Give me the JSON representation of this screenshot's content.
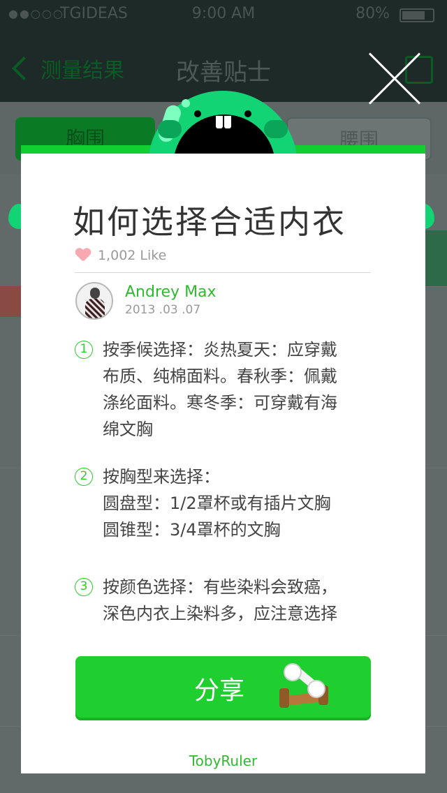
{
  "status_bar": {
    "signal": "●●○○○",
    "carrier": "TGIDEAS",
    "time": "9:00 AM",
    "battery": "80%"
  },
  "nav": {
    "back_label": "测量结果",
    "title": "改善贴士"
  },
  "segments": {
    "left": "胸围",
    "right": "腰围"
  },
  "card": {
    "title": "如何选择合适内衣",
    "likes": "1,002 Like",
    "author": {
      "name": "Andrey Max",
      "date": "2013 .03 .07"
    },
    "tips": [
      {
        "number": "1",
        "lines": [
          "按季候选择：炎热夏天：应穿戴",
          "布质、纯棉面料。春秋季：佩戴",
          "涤纶面料。寒冬季：可穿戴有海",
          "绵文胸"
        ]
      },
      {
        "number": "2",
        "lines": [
          "按胸型来选择：",
          "圆盘型：1/2罩杯或有插片文胸",
          "圆锥型：3/4罩杯的文胸"
        ]
      },
      {
        "number": "3",
        "lines": [
          "按颜色选择：有些染料会致癌，",
          "深色内衣上染料多，应注意选择"
        ]
      }
    ],
    "share_label": "分享",
    "footer": "TobyRuler"
  },
  "colors": {
    "accent_green": "#1ecf2f",
    "mascot_green": "#12d475",
    "title_text": "#333333"
  },
  "icons": [
    "close-icon",
    "heart-icon",
    "dumbbell-icon",
    "edit-icon",
    "chevron-left-icon"
  ]
}
